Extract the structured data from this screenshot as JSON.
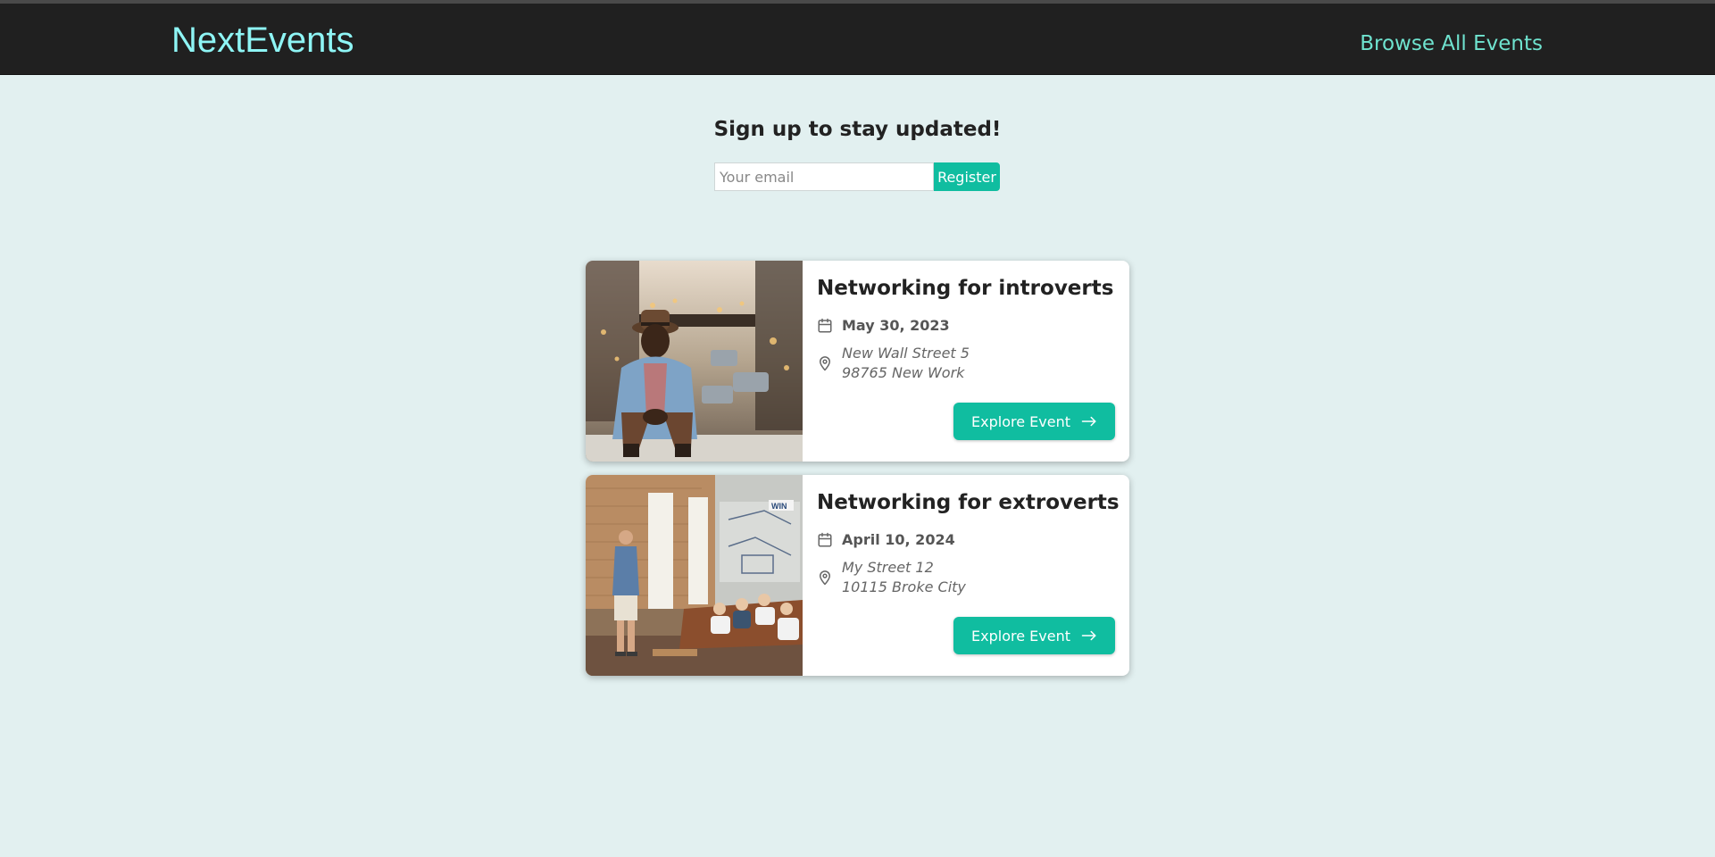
{
  "header": {
    "logo": "NextEvents",
    "nav_link": "Browse All Events",
    "bg_color": "#202020",
    "logo_color": "#8ef5f5",
    "link_color": "#6fe3cf"
  },
  "newsletter": {
    "title": "Sign up to stay updated!",
    "email_placeholder": "Your email",
    "email_value": "",
    "register_label": "Register"
  },
  "events": [
    {
      "title": "Networking for introverts",
      "date": "May 30, 2023",
      "address": "New Wall Street 5\n98765 New Work",
      "button_label": "Explore Event",
      "image": "photo-man-sitting-city-street"
    },
    {
      "title": "Networking for extroverts",
      "date": "April 10, 2024",
      "address": "My Street 12\n10115 Broke City",
      "button_label": "Explore Event",
      "image": "photo-speaker-presenting-office"
    }
  ],
  "icons": {
    "date": "calendar-icon",
    "address": "map-pin-icon",
    "explore": "arrow-right-icon"
  },
  "colors": {
    "page_bg": "#e2f0f0",
    "accent": "#10bda0"
  }
}
